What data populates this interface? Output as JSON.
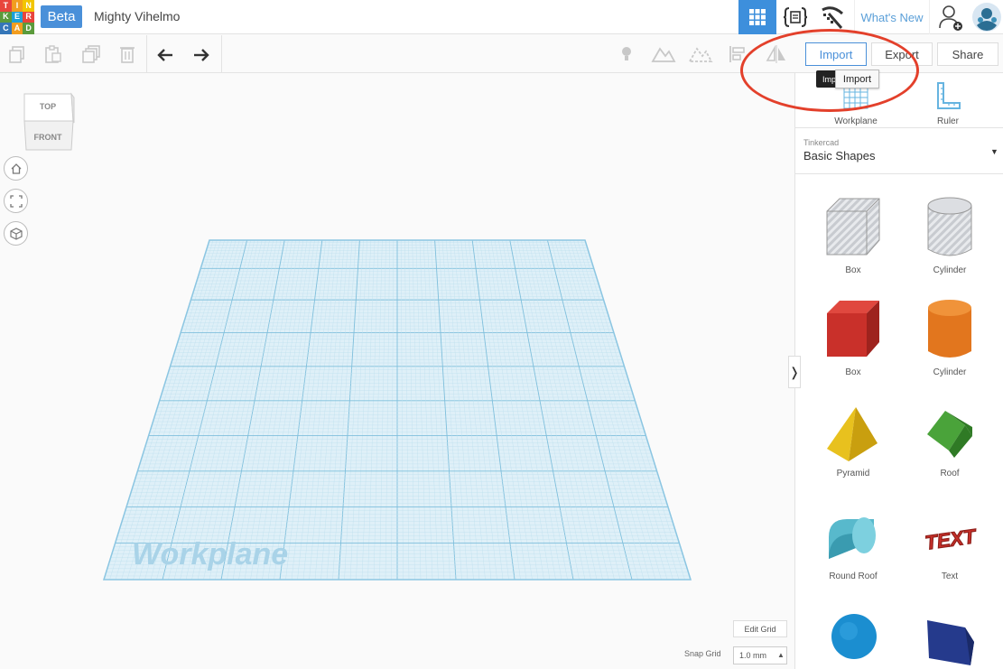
{
  "header": {
    "logo_letters": [
      "T",
      "I",
      "N",
      "K",
      "E",
      "R",
      "C",
      "A",
      "D"
    ],
    "logo_colors": [
      "#e8453c",
      "#f29d1f",
      "#f2c500",
      "#5b9b3c",
      "#1ba0d8",
      "#e8453c",
      "#3576b8",
      "#f29d1f",
      "#5b9b3c"
    ],
    "badge": "Beta",
    "design_name": "Mighty Vihelmo",
    "whats_new": "What's New",
    "icons": [
      "grid-view-icon",
      "codeblocks-icon",
      "minecraft-icon",
      "add-user-icon",
      "avatar-icon"
    ]
  },
  "toolbar": {
    "tools": [
      "copy-icon",
      "paste-icon",
      "duplicate-icon",
      "delete-icon",
      "undo-icon",
      "redo-icon",
      "light-icon",
      "shape-solid-icon",
      "shape-hole-icon",
      "align-icon",
      "mirror-icon"
    ],
    "import_label": "Import",
    "export_label": "Export",
    "share_label": "Share",
    "tooltip_dark": "Imp",
    "tooltip_light": "Import"
  },
  "viewcube": {
    "top": "TOP",
    "front": "FRONT"
  },
  "nav_icons": [
    "home-icon",
    "fit-view-icon",
    "ortho-view-icon"
  ],
  "workplane": {
    "label": "Workplane"
  },
  "panel": {
    "top_items": [
      {
        "label": "Workplane",
        "icon": "workplane-icon"
      },
      {
        "label": "Ruler",
        "icon": "ruler-icon"
      }
    ],
    "library_source": "Tinkercad",
    "library_name": "Basic Shapes",
    "shapes": [
      {
        "label": "Box",
        "icon": "box-hole-icon"
      },
      {
        "label": "Cylinder",
        "icon": "cylinder-hole-icon"
      },
      {
        "label": "Box",
        "icon": "box-icon"
      },
      {
        "label": "Cylinder",
        "icon": "cylinder-icon"
      },
      {
        "label": "Pyramid",
        "icon": "pyramid-icon"
      },
      {
        "label": "Roof",
        "icon": "roof-icon"
      },
      {
        "label": "Round Roof",
        "icon": "round-roof-icon"
      },
      {
        "label": "Text",
        "icon": "text-shape-icon"
      },
      {
        "label": "",
        "icon": "sphere-icon"
      },
      {
        "label": "",
        "icon": "polygon-icon"
      }
    ],
    "shape_text_glyph": "TEXT"
  },
  "bottom": {
    "edit_grid": "Edit Grid",
    "snap_label": "Snap Grid",
    "snap_value": "1.0 mm"
  },
  "colors": {
    "accent": "#3d8fdc",
    "highlight_circle": "#e3402b",
    "grid": "#a8d4ea"
  }
}
